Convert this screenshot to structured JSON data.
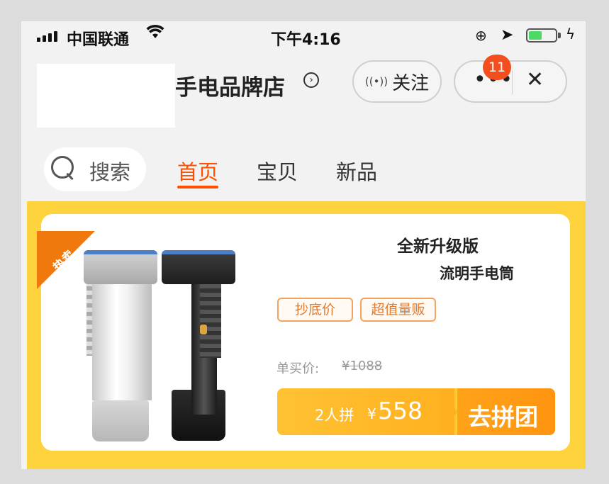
{
  "status_bar": {
    "carrier": "中国联通",
    "time": "下午4:16",
    "battery_color": "#4cd964"
  },
  "header": {
    "store_name": "手电品牌店",
    "follow_label": "关注",
    "notification_count": "11"
  },
  "nav": {
    "search_label": "搜索",
    "tabs": [
      {
        "label": "首页",
        "active": true
      },
      {
        "label": "宝贝",
        "active": false
      },
      {
        "label": "新品",
        "active": false
      }
    ],
    "active_color": "#ff5000"
  },
  "promo": {
    "ribbon_label": "热卖",
    "title_line1": "全新升级版",
    "title_line2": "流明手电筒",
    "tags": [
      "抄底价",
      "超值量贩"
    ],
    "single_price_label": "单买价:",
    "single_price": "¥1088",
    "group_people": "2人拼",
    "group_currency": "¥",
    "group_price": "558",
    "group_button": "去拼团",
    "background_color": "#ffd33d"
  }
}
